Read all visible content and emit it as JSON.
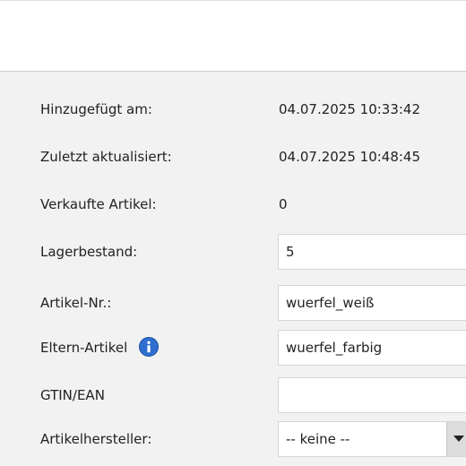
{
  "form": {
    "added": {
      "label": "Hinzugefügt am:",
      "value": "04.07.2025 10:33:42"
    },
    "updated": {
      "label": "Zuletzt aktualisiert:",
      "value": "04.07.2025 10:48:45"
    },
    "sold": {
      "label": "Verkaufte Artikel:",
      "value": "0"
    },
    "stock": {
      "label": "Lagerbestand:",
      "value": "5"
    },
    "article_no": {
      "label": "Artikel-Nr.:",
      "value": "wuerfel_weiß"
    },
    "parent": {
      "label": "Eltern-Artikel",
      "value": "wuerfel_farbig",
      "icon": "info-icon"
    },
    "gtin": {
      "label": "GTIN/EAN",
      "value": ""
    },
    "manufacturer": {
      "label": "Artikelhersteller:",
      "selected": "-- keine --",
      "icon": "chevron-down-icon"
    }
  },
  "colors": {
    "info_icon": "#2f6fd0",
    "background": "#f2f2f2"
  }
}
